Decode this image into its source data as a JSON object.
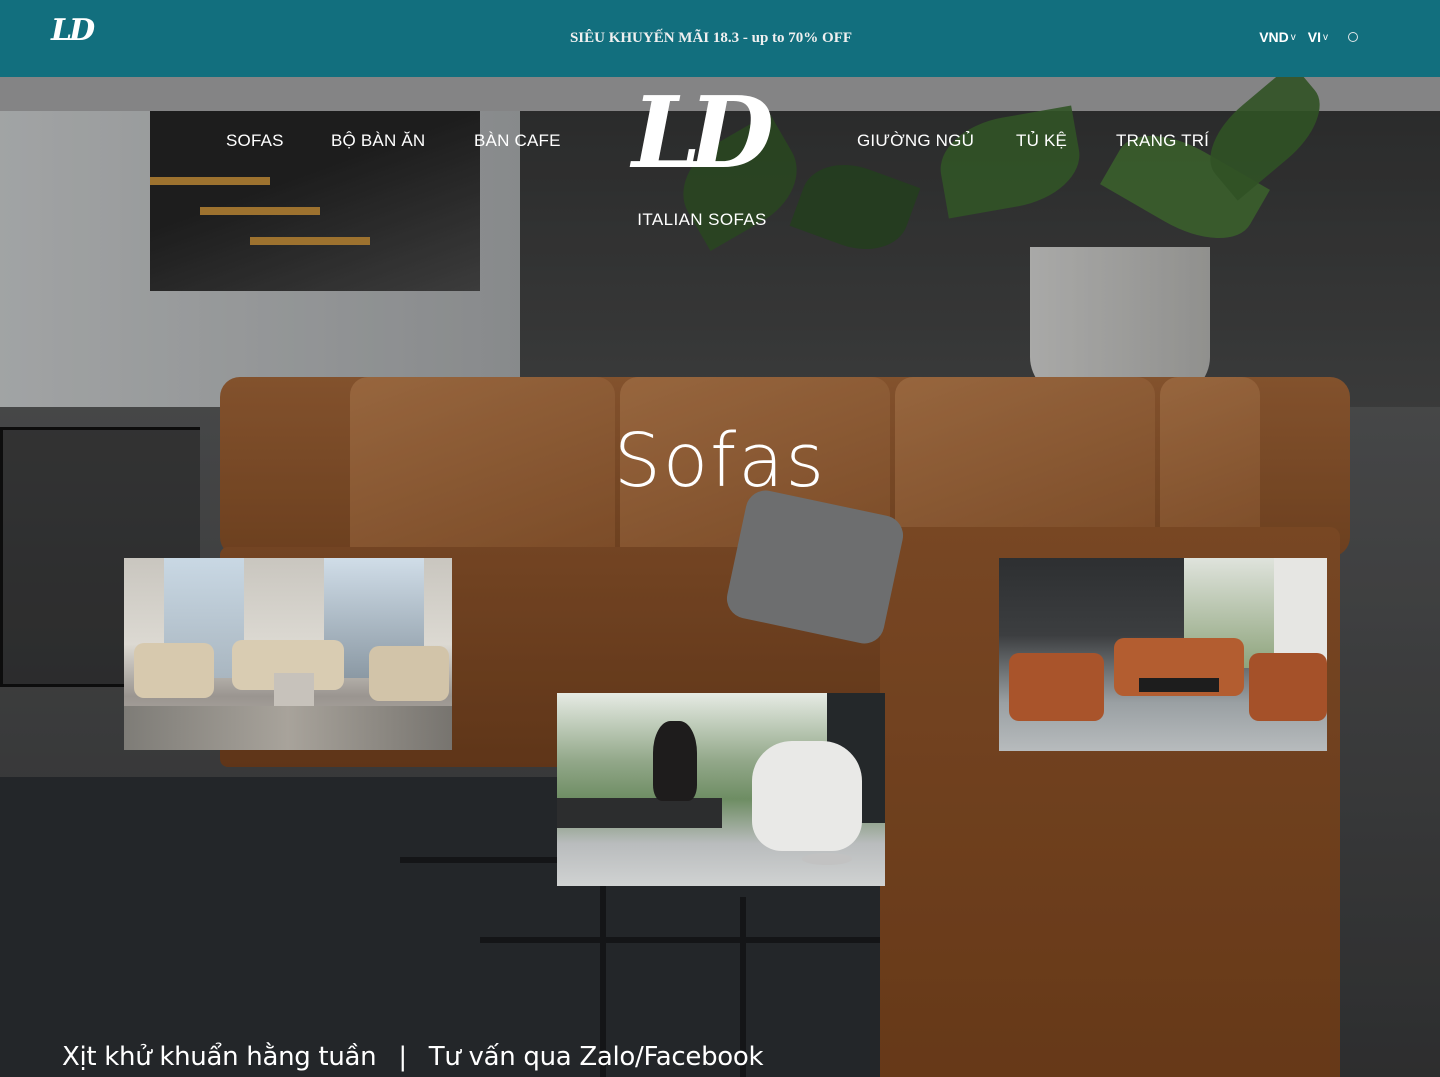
{
  "topbar": {
    "logo": "LD",
    "promo": "SIÊU KHUYẾN MÃI 18.3 - up to 70% OFF",
    "currency": "VND",
    "language": "VI",
    "search_icon": "search-icon",
    "background": "#126f7e"
  },
  "nav": {
    "left": [
      "SOFAS",
      "BỘ BÀN ĂN",
      "BÀN CAFE"
    ],
    "right": [
      "GIƯỜNG NGỦ",
      "TỦ KỆ",
      "TRANG TRÍ"
    ],
    "brand_mark": "LD",
    "brand_tagline": "ITALIAN SOFAS"
  },
  "hero": {
    "title": "Sofas"
  },
  "featured_images": [
    {
      "name": "beige-leather-living-room"
    },
    {
      "name": "white-armchair-with-bust"
    },
    {
      "name": "brown-leather-showroom"
    }
  ],
  "bottom_links": {
    "link1": "Xịt khử khuẩn hằng tuần",
    "separator": "|",
    "link2": "Tư vấn qua Zalo/Facebook"
  }
}
